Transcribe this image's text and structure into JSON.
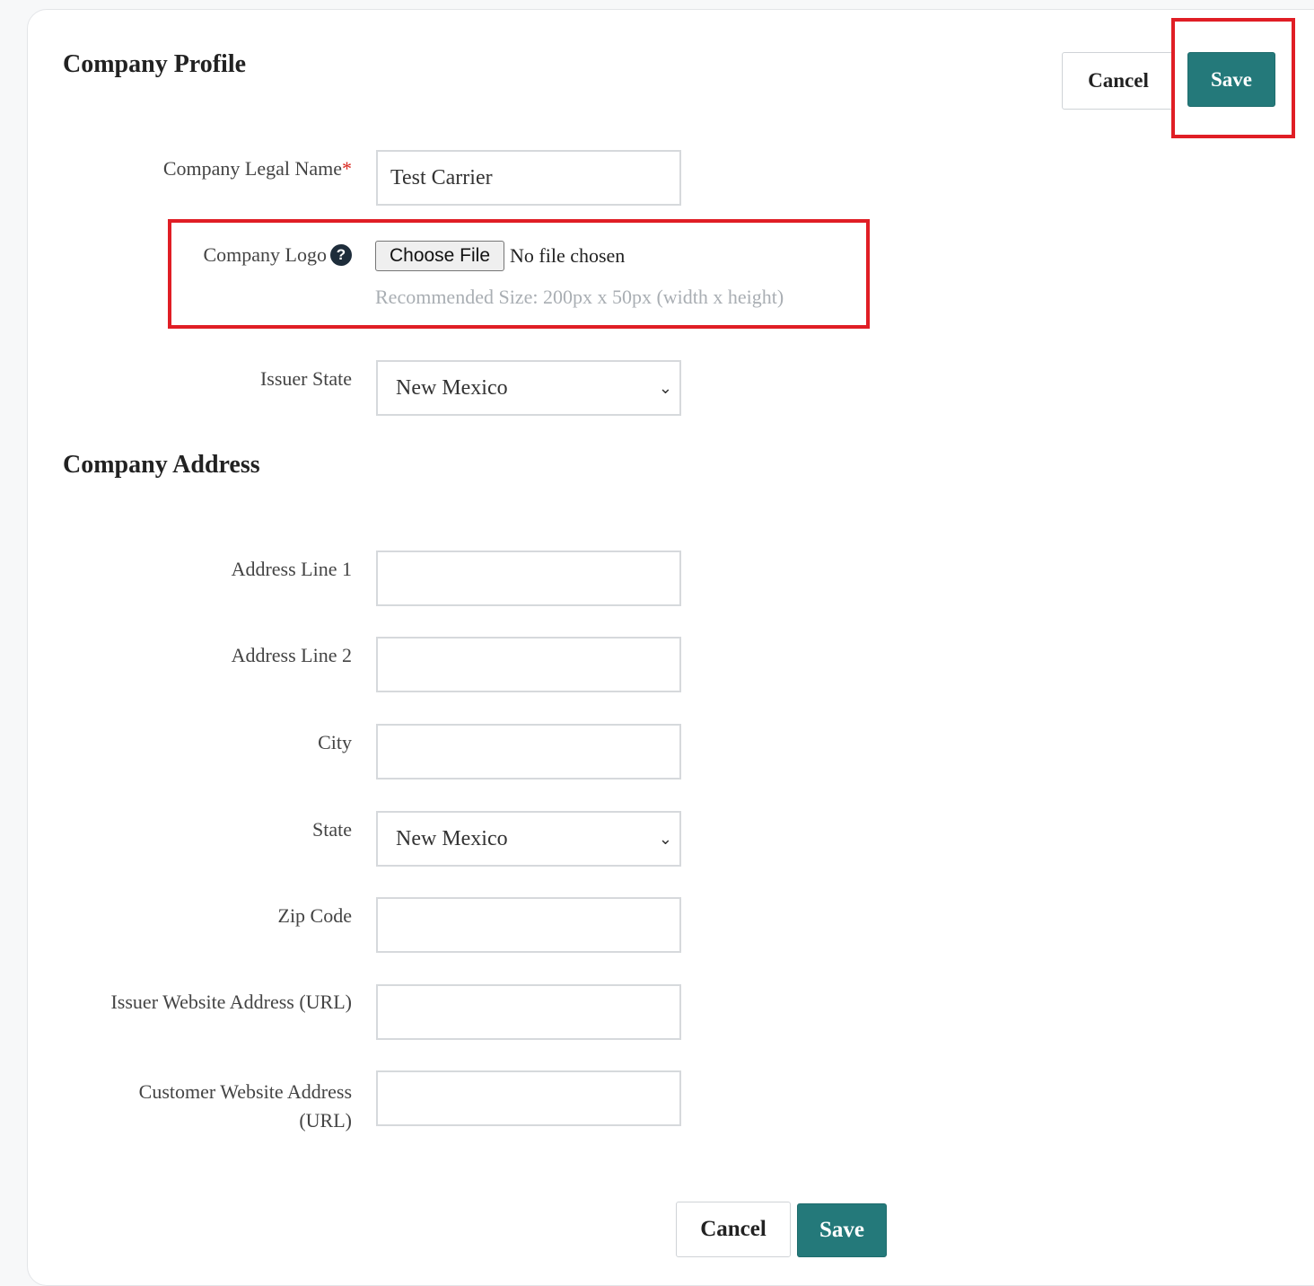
{
  "header": {
    "title": "Company Profile",
    "cancel_label": "Cancel",
    "save_label": "Save"
  },
  "profile": {
    "legal_name_label": "Company Legal Name",
    "required_marker": "*",
    "legal_name_value": "Test Carrier",
    "logo_label": "Company Logo",
    "logo_help_glyph": "?",
    "choose_file_label": "Choose File",
    "no_file_text": "No file chosen",
    "logo_hint": "Recommended Size: 200px x 50px (width x height)",
    "issuer_state_label": "Issuer State",
    "issuer_state_value": "New Mexico"
  },
  "address": {
    "title": "Company Address",
    "line1_label": "Address Line 1",
    "line1_value": "",
    "line2_label": "Address Line 2",
    "line2_value": "",
    "city_label": "City",
    "city_value": "",
    "state_label": "State",
    "state_value": "New Mexico",
    "zip_label": "Zip Code",
    "zip_value": "",
    "issuer_url_label": "Issuer Website Address (URL)",
    "issuer_url_value": "",
    "customer_url_label_1": "Customer Website Address",
    "customer_url_label_2": "(URL)",
    "customer_url_value": ""
  },
  "footer": {
    "cancel_label": "Cancel",
    "save_label": "Save"
  },
  "colors": {
    "save_button": "#24797a",
    "highlight_box": "#e01e25",
    "required": "#d9251d"
  }
}
